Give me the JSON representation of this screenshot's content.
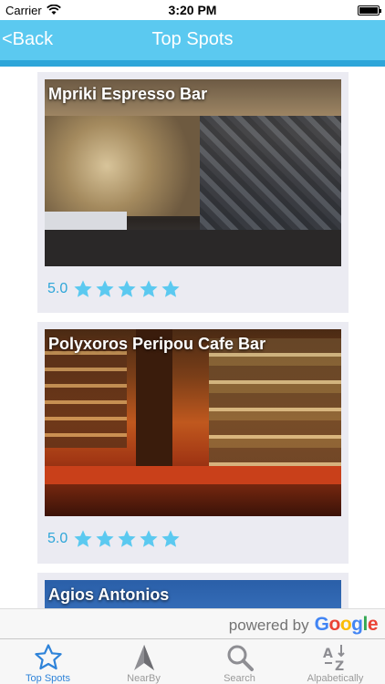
{
  "status_bar": {
    "carrier": "Carrier",
    "time": "3:20 PM"
  },
  "nav": {
    "back_label": "<Back",
    "title": "Top Spots"
  },
  "spots": [
    {
      "name": "Mpriki Espresso Bar",
      "rating": "5.0",
      "stars": 5
    },
    {
      "name": "Polyxoros Peripou Cafe Bar",
      "rating": "5.0",
      "stars": 5
    },
    {
      "name": "Agios Antonios",
      "rating": "",
      "stars": 0
    }
  ],
  "footer": {
    "powered_by": "powered by",
    "google": "Google"
  },
  "tabs": [
    {
      "label": "Top Spots",
      "icon": "star-icon",
      "active": true
    },
    {
      "label": "NearBy",
      "icon": "navigation-arrow-icon",
      "active": false
    },
    {
      "label": "Search",
      "icon": "magnifier-icon",
      "active": false
    },
    {
      "label": "Alpabetically",
      "icon": "sort-alpha-icon",
      "active": false
    }
  ],
  "colors": {
    "accent": "#5bc9f0",
    "accent_dark": "#2ea6d9",
    "tab_active": "#2e83d9",
    "star": "#5bc9f0"
  }
}
